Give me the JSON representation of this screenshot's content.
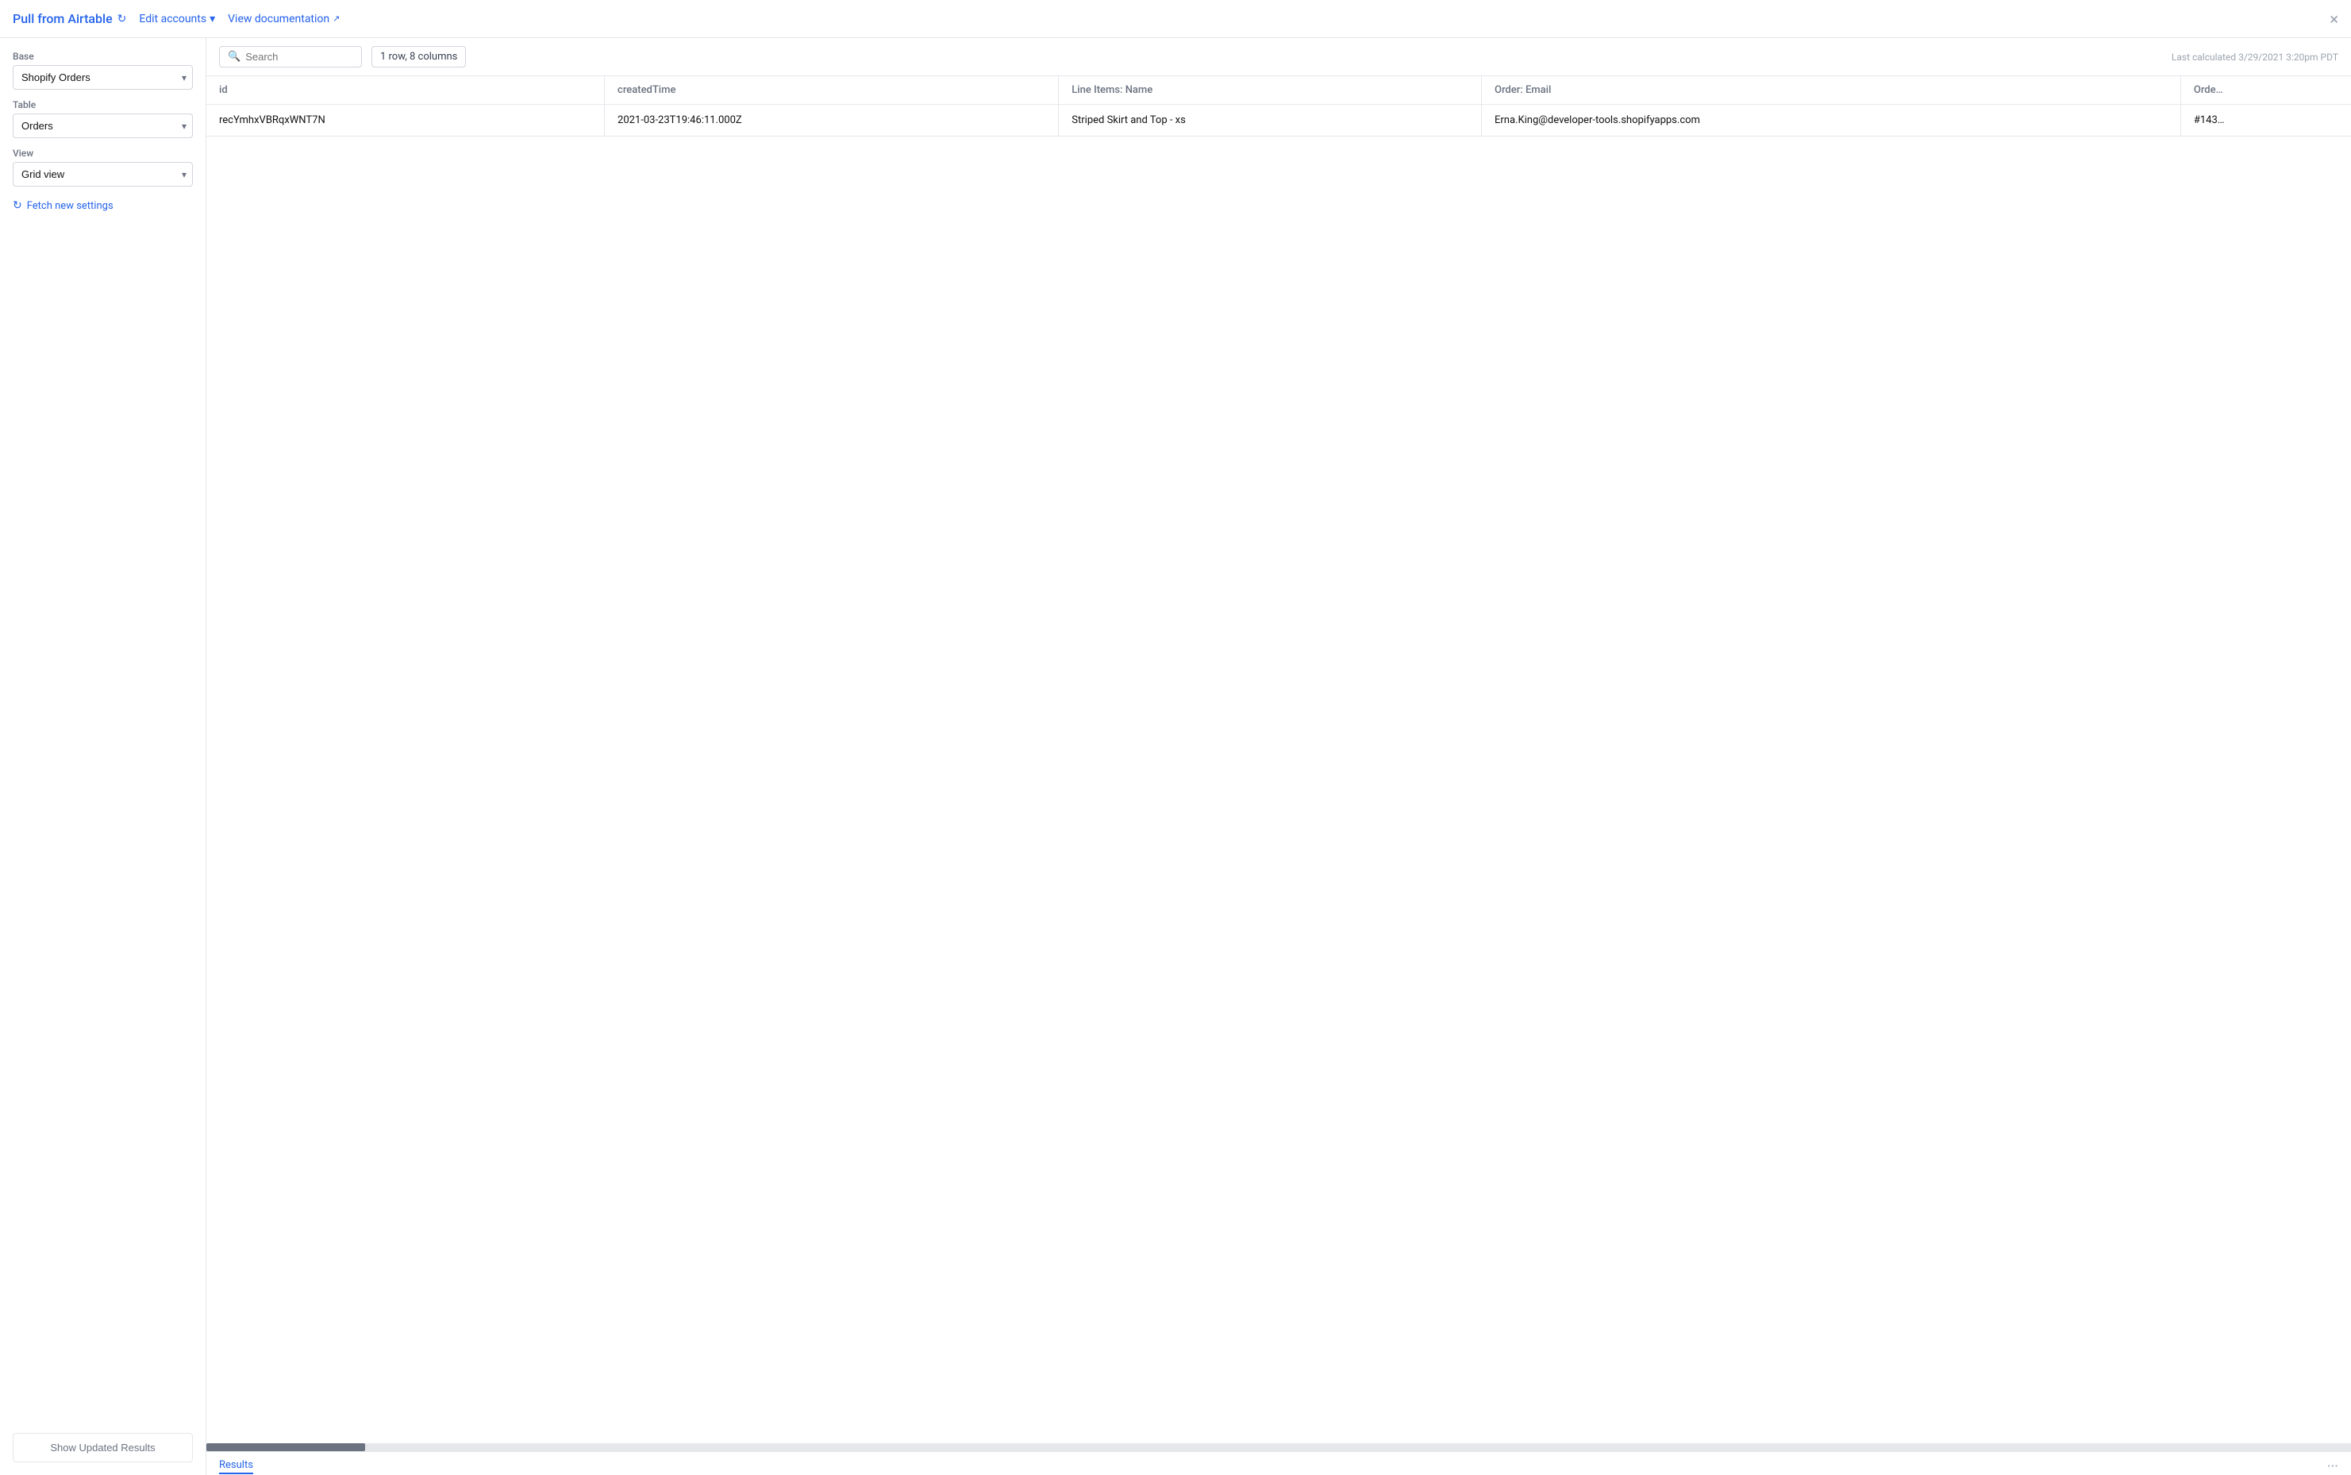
{
  "header": {
    "title": "Pull from Airtable",
    "edit_accounts_label": "Edit accounts",
    "view_docs_label": "View documentation"
  },
  "sidebar": {
    "base_label": "Base",
    "base_value": "Shopify Orders",
    "table_label": "Table",
    "table_value": "Orders",
    "view_label": "View",
    "view_value": "Grid view",
    "fetch_label": "Fetch new settings",
    "show_updated_label": "Show Updated Results"
  },
  "content": {
    "search_placeholder": "Search",
    "row_count": "1 row, 8 columns",
    "last_calculated": "Last calculated 3/29/2021 3:20pm PDT",
    "columns": [
      {
        "id": "col-id",
        "label": "id"
      },
      {
        "id": "col-created-time",
        "label": "createdTime"
      },
      {
        "id": "col-line-items-name",
        "label": "Line Items: Name"
      },
      {
        "id": "col-order-email",
        "label": "Order: Email"
      },
      {
        "id": "col-order-num",
        "label": "Orde…"
      }
    ],
    "rows": [
      {
        "id": "recYmhxVBRqxWNT7N",
        "createdTime": "2021-03-23T19:46:11.000Z",
        "lineItemsName": "Striped Skirt and Top - xs",
        "orderEmail": "Erna.King@developer-tools.shopifyapps.com",
        "orderNum": "#143…"
      }
    ]
  },
  "footer": {
    "results_tab": "Results"
  }
}
